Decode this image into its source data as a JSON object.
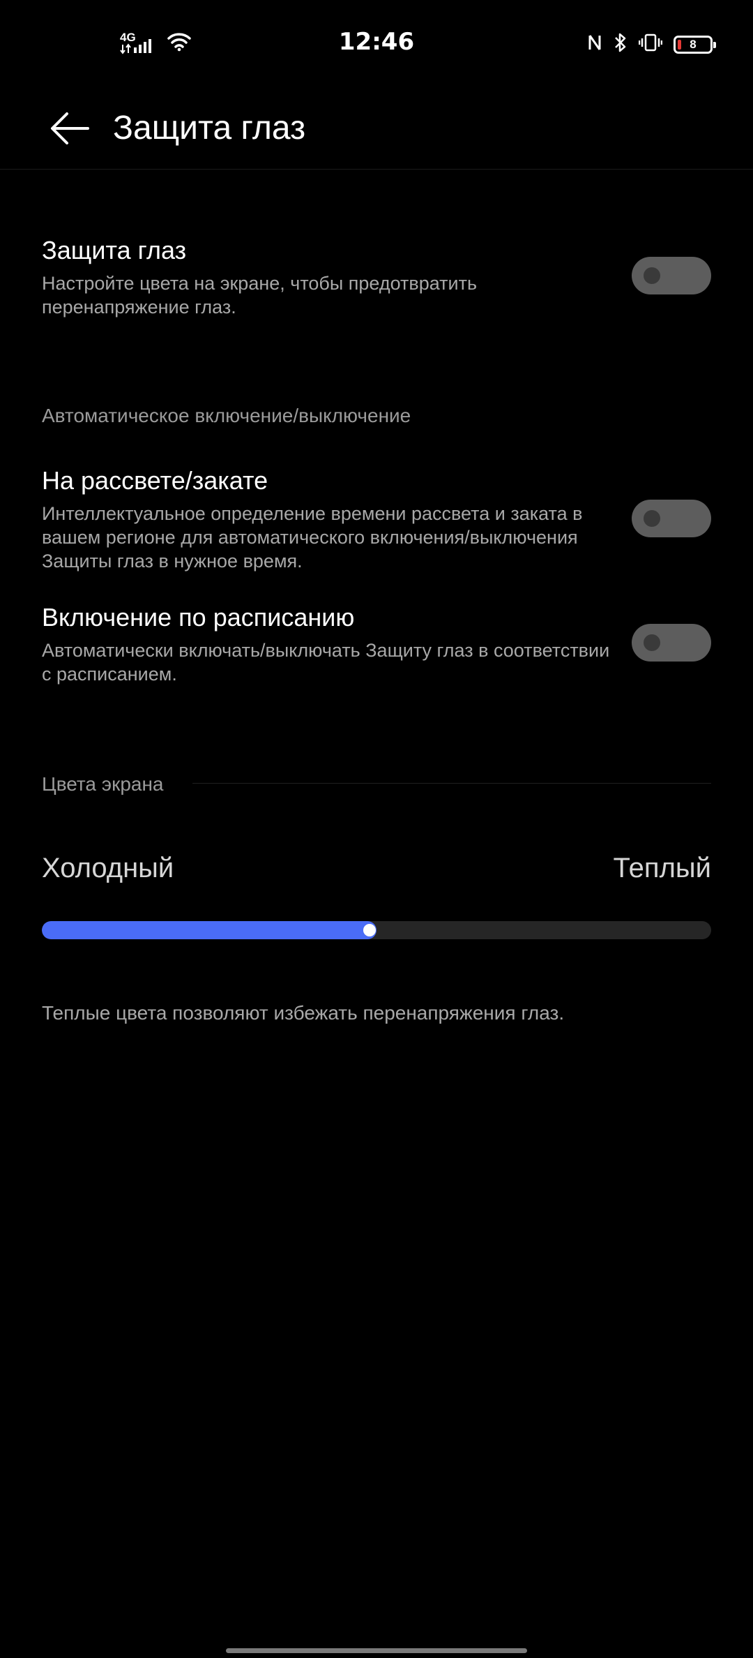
{
  "status_bar": {
    "time": "12:46",
    "network": "4G",
    "battery_level": "8",
    "icons": [
      "signal-icon",
      "wifi-icon",
      "nfc-icon",
      "bluetooth-icon",
      "vibrate-icon",
      "battery-icon"
    ]
  },
  "app_bar": {
    "title": "Защита глаз",
    "back_icon": "arrow-left-icon"
  },
  "eye_protection": {
    "title": "Защита глаз",
    "description": "Настройте цвета на экране, чтобы предотвратить перенапряжение глаз.",
    "enabled": false
  },
  "auto_section": {
    "header": "Автоматическое включение/выключение",
    "items": [
      {
        "title": "На рассвете/закате",
        "description": "Интеллектуальное определение времени рассвета и заката в вашем регионе для автоматического включения/выключения Защиты глаз в нужное время.",
        "enabled": false
      },
      {
        "title": "Включение по расписанию",
        "description": "Автоматически включать/выключать Защиту глаз в соответствии с расписанием.",
        "enabled": false
      }
    ]
  },
  "screen_colors": {
    "header": "Цвета экрана",
    "cold_label": "Холодный",
    "warm_label": "Теплый",
    "temperature_fraction": 0.49,
    "note": "Теплые цвета позволяют избежать перенапряжения глаз.",
    "accent_color": "#4a6cf7"
  }
}
